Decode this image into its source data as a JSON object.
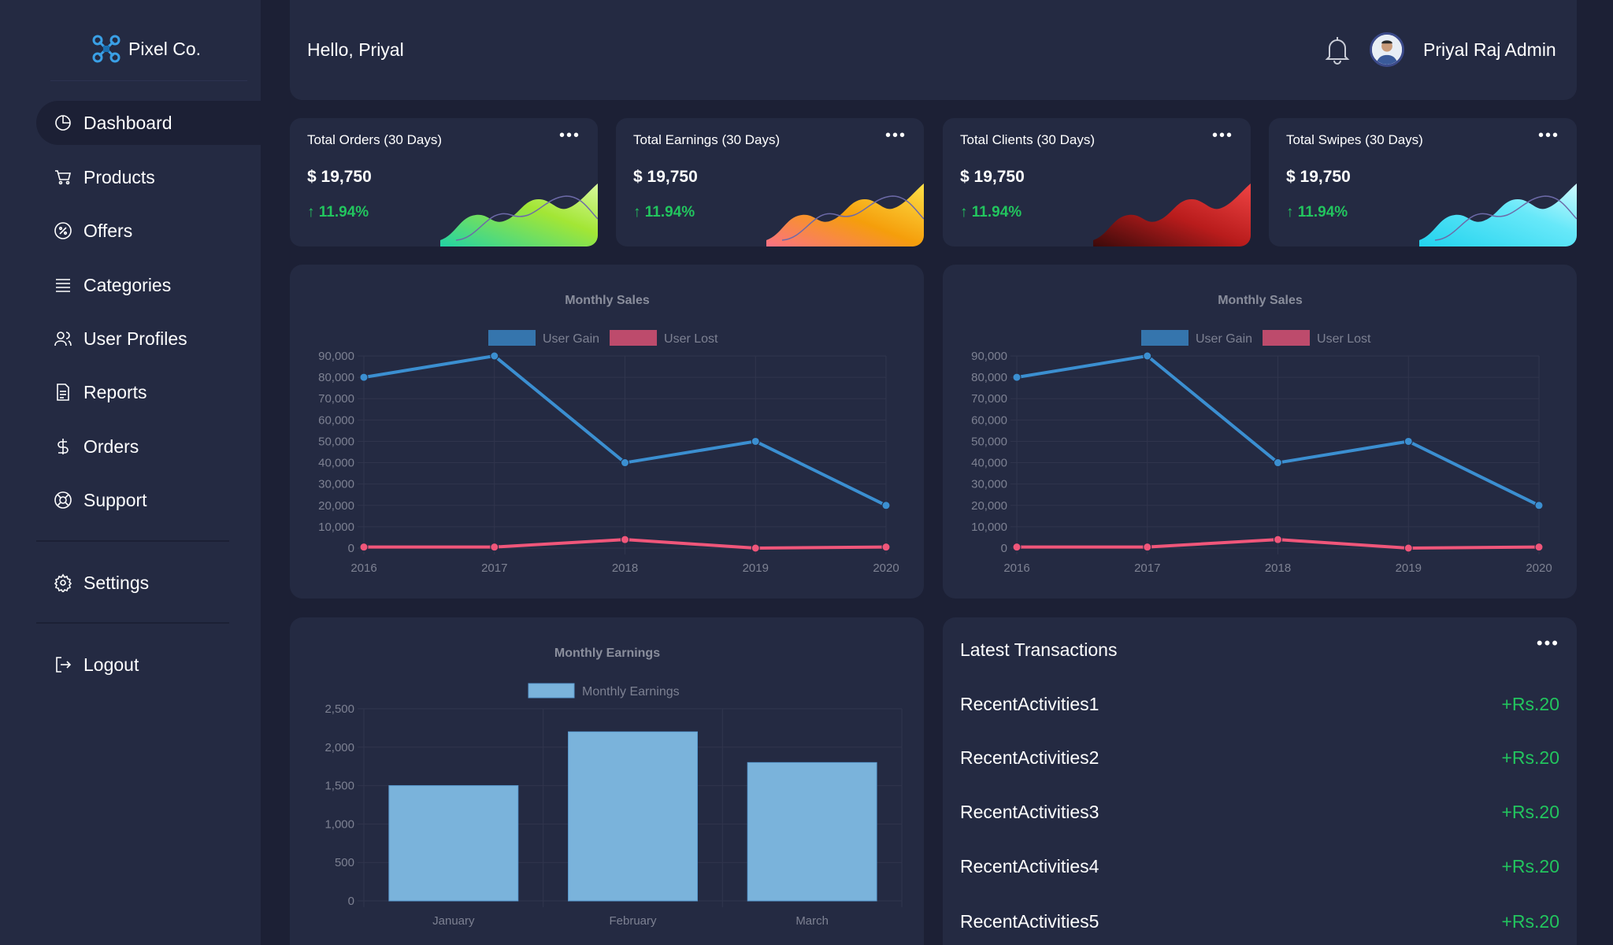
{
  "brand": {
    "name": "Pixel Co.",
    "logo_icon": "drone-icon"
  },
  "nav": {
    "items": [
      {
        "label": "Dashboard",
        "icon": "pie-chart-icon",
        "active": true
      },
      {
        "label": "Products",
        "icon": "cart-icon"
      },
      {
        "label": "Offers",
        "icon": "percent-badge-icon"
      },
      {
        "label": "Categories",
        "icon": "list-icon"
      },
      {
        "label": "User Profiles",
        "icon": "users-icon"
      },
      {
        "label": "Reports",
        "icon": "document-icon"
      },
      {
        "label": "Orders",
        "icon": "dollar-icon"
      },
      {
        "label": "Support",
        "icon": "lifebuoy-icon"
      }
    ],
    "settings": {
      "label": "Settings",
      "icon": "gear-icon"
    },
    "logout": {
      "label": "Logout",
      "icon": "logout-icon"
    }
  },
  "header": {
    "greeting": "Hello, Priyal",
    "user_name": "Priyal Raj Admin"
  },
  "stats": [
    {
      "title": "Total Orders (30 Days)",
      "value": "$ 19,750",
      "change": "↑ 11.94%",
      "colors": [
        "#22d3a5",
        "#a3e635",
        "#d9f99d"
      ]
    },
    {
      "title": "Total Earnings (30 Days)",
      "value": "$ 19,750",
      "change": "↑ 11.94%",
      "colors": [
        "#fb7185",
        "#f59e0b",
        "#fde047"
      ]
    },
    {
      "title": "Total Clients (30 Days)",
      "value": "$ 19,750",
      "change": "↑ 11.94%",
      "colors": [
        "#3b0a0a",
        "#b91c1c",
        "#ef4444"
      ]
    },
    {
      "title": "Total Swipes (30 Days)",
      "value": "$ 19,750",
      "change": "↑ 11.94%",
      "colors": [
        "#22d3ee",
        "#67e8f9",
        "#cffafe"
      ]
    }
  ],
  "colors": {
    "accent_green": "#22c55e",
    "gain": "#3b8fd1",
    "lost": "#f0567a",
    "bar": "#7ab3db"
  },
  "chart_data": [
    {
      "type": "line",
      "title": "Monthly Sales",
      "x": [
        "2016",
        "2017",
        "2018",
        "2019",
        "2020"
      ],
      "series": [
        {
          "name": "User Gain",
          "values": [
            80000,
            90000,
            40000,
            50000,
            20000
          ]
        },
        {
          "name": "User Lost",
          "values": [
            500,
            500,
            4000,
            0,
            500
          ]
        }
      ],
      "ylim": [
        0,
        90000
      ],
      "yticks": [
        "90,000",
        "80,000",
        "70,000",
        "60,000",
        "50,000",
        "40,000",
        "30,000",
        "20,000",
        "10,000",
        "0"
      ],
      "legend": "top",
      "grid": true
    },
    {
      "type": "line",
      "title": "Monthly Sales",
      "x": [
        "2016",
        "2017",
        "2018",
        "2019",
        "2020"
      ],
      "series": [
        {
          "name": "User Gain",
          "values": [
            80000,
            90000,
            40000,
            50000,
            20000
          ]
        },
        {
          "name": "User Lost",
          "values": [
            500,
            500,
            4000,
            0,
            500
          ]
        }
      ],
      "ylim": [
        0,
        90000
      ],
      "yticks": [
        "90,000",
        "80,000",
        "70,000",
        "60,000",
        "50,000",
        "40,000",
        "30,000",
        "20,000",
        "10,000",
        "0"
      ],
      "legend": "top",
      "grid": true
    },
    {
      "type": "bar",
      "title": "Monthly Earnings",
      "categories": [
        "January",
        "February",
        "March"
      ],
      "series": [
        {
          "name": "Monthly Earnings",
          "values": [
            1500,
            2200,
            1800
          ]
        }
      ],
      "ylim": [
        0,
        2500
      ],
      "yticks": [
        "2,500",
        "2,000",
        "1,500",
        "1,000",
        "500",
        "0"
      ],
      "legend": "top",
      "grid": true
    }
  ],
  "transactions": {
    "title": "Latest Transactions",
    "rows": [
      {
        "name": "RecentActivities1",
        "amount": "+Rs.20"
      },
      {
        "name": "RecentActivities2",
        "amount": "+Rs.20"
      },
      {
        "name": "RecentActivities3",
        "amount": "+Rs.20"
      },
      {
        "name": "RecentActivities4",
        "amount": "+Rs.20"
      },
      {
        "name": "RecentActivities5",
        "amount": "+Rs.20"
      }
    ]
  }
}
